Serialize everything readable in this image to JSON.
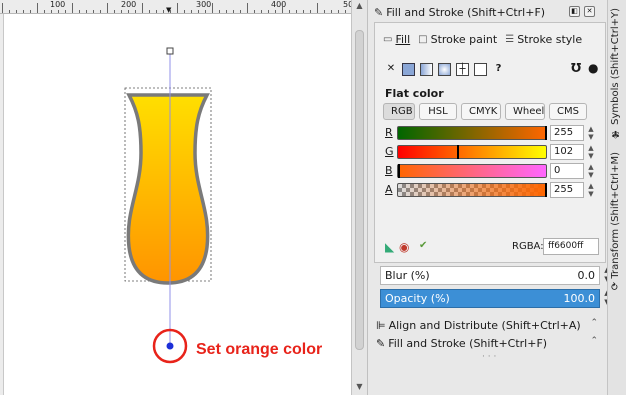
{
  "ruler": {
    "labels": [
      "100",
      "200",
      "300",
      "400",
      "50"
    ]
  },
  "annotation": {
    "text": "Set orange color",
    "color": "#e8231a"
  },
  "fill_stroke": {
    "title": "Fill and Stroke (Shift+Ctrl+F)",
    "tabs": [
      {
        "label": "Fill",
        "icon": "fill-icon",
        "active": true
      },
      {
        "label": "Stroke paint",
        "icon": "stroke-paint-icon"
      },
      {
        "label": "Stroke style",
        "icon": "stroke-style-icon"
      }
    ],
    "paint_modes": [
      "none",
      "flat",
      "linear-gradient",
      "radial-gradient",
      "mesh",
      "pattern",
      "unset"
    ],
    "unset_glyph": "?",
    "flat_color_label": "Flat color",
    "color_modes": [
      "RGB",
      "HSL",
      "CMYK",
      "Wheel",
      "CMS"
    ],
    "active_color_mode": "RGB",
    "channels": [
      {
        "label": "R",
        "value": "255"
      },
      {
        "label": "G",
        "value": "102"
      },
      {
        "label": "B",
        "value": "0"
      },
      {
        "label": "A",
        "value": "255"
      }
    ],
    "rgba_label": "RGBA:",
    "rgba_value": "ff6600ff",
    "blur_label": "Blur (%)",
    "blur_value": "0.0",
    "opacity_label": "Opacity (%)",
    "opacity_value": "100.0"
  },
  "collapsed_panels": [
    {
      "title": "Align and Distribute (Shift+Ctrl+A)",
      "icon": "align-icon"
    },
    {
      "title": "Fill and Stroke (Shift+Ctrl+F)",
      "icon": "fill-stroke-icon"
    }
  ],
  "side_tabs": [
    {
      "label": "Symbols (Shift+Ctrl+Y)",
      "icon": "symbols-icon"
    },
    {
      "label": "Transform (Shift+Ctrl+M)",
      "icon": "transform-icon"
    }
  ],
  "colors": {
    "orange": "#ff6600",
    "gradient_top": "#ffd800",
    "gradient_bottom": "#ff9200",
    "selection_blue": "#3c8fd6"
  }
}
